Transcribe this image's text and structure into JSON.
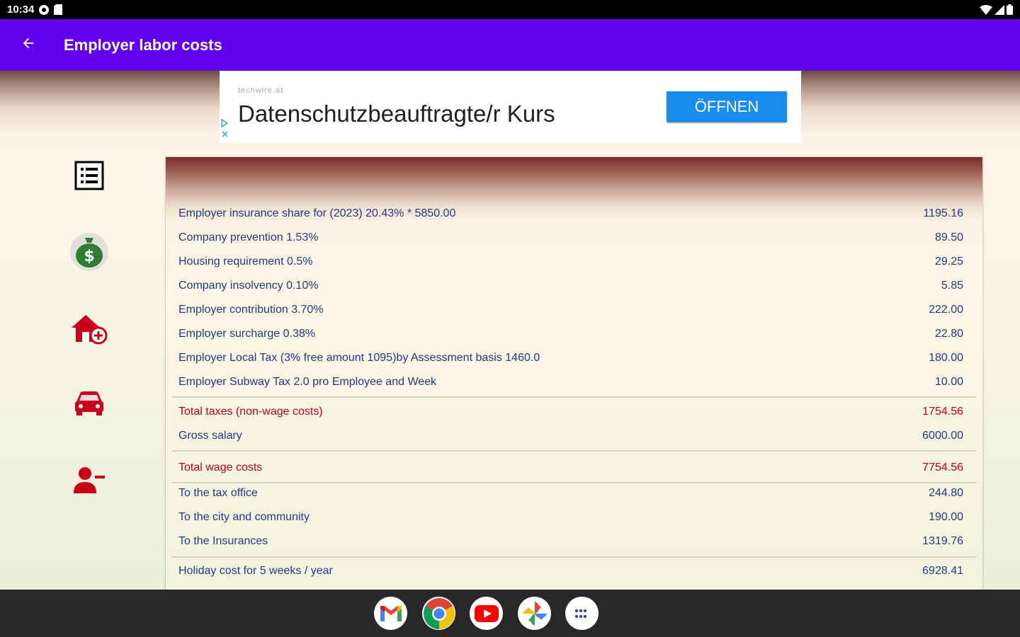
{
  "status_bar": {
    "time": "10:34"
  },
  "app_bar": {
    "title": "Employer labor costs",
    "back_icon": "arrow-back-icon"
  },
  "ad": {
    "sponsor": "techwire.at",
    "headline": "Datenschutzbeauftragte/r Kurs",
    "button_label": "ÖFFNEN"
  },
  "side_nav": {
    "items": [
      {
        "icon": "list-icon"
      },
      {
        "icon": "money-bag-icon"
      },
      {
        "icon": "home-add-icon"
      },
      {
        "icon": "car-icon"
      },
      {
        "icon": "user-remove-icon"
      }
    ]
  },
  "table": {
    "rows": [
      {
        "label": "Employer insurance share for (2023) 20.43% * 5850.00",
        "value": "1195.16"
      },
      {
        "label": "Company prevention 1.53%",
        "value": "89.50"
      },
      {
        "label": "Housing requirement 0.5%",
        "value": "29.25"
      },
      {
        "label": "Company insolvency 0.10%",
        "value": "5.85"
      },
      {
        "label": "Employer contribution 3.70%",
        "value": "222.00"
      },
      {
        "label": "Employer surcharge 0.38%",
        "value": "22.80"
      },
      {
        "label": "Employer Local Tax (3% free amount 1095)by Assessment basis 1460.0",
        "value": "180.00"
      },
      {
        "label": "Employer Subway Tax 2.0 pro Employee and Week",
        "value": "10.00"
      },
      {
        "label": "Total taxes (non-wage costs)",
        "value": "1754.56"
      },
      {
        "label": "Gross salary",
        "value": "6000.00"
      },
      {
        "label": "Total wage costs",
        "value": "7754.56"
      },
      {
        "label": "To the tax office",
        "value": "244.80"
      },
      {
        "label": "To the city and community",
        "value": "190.00"
      },
      {
        "label": "To the Insurances",
        "value": "1319.76"
      },
      {
        "label": "Holiday cost for 5 weeks / year",
        "value": "6928.41"
      }
    ]
  },
  "dock": {
    "apps": [
      "gmail-icon",
      "chrome-icon",
      "youtube-icon",
      "photos-icon",
      "app-drawer-icon"
    ]
  },
  "colors": {
    "app_bar": "#6200ee",
    "row_text": "#1f3a8a",
    "total_text": "#c0001b",
    "ad_button": "#1a8cf0",
    "nav_icon": "#c8001a"
  }
}
